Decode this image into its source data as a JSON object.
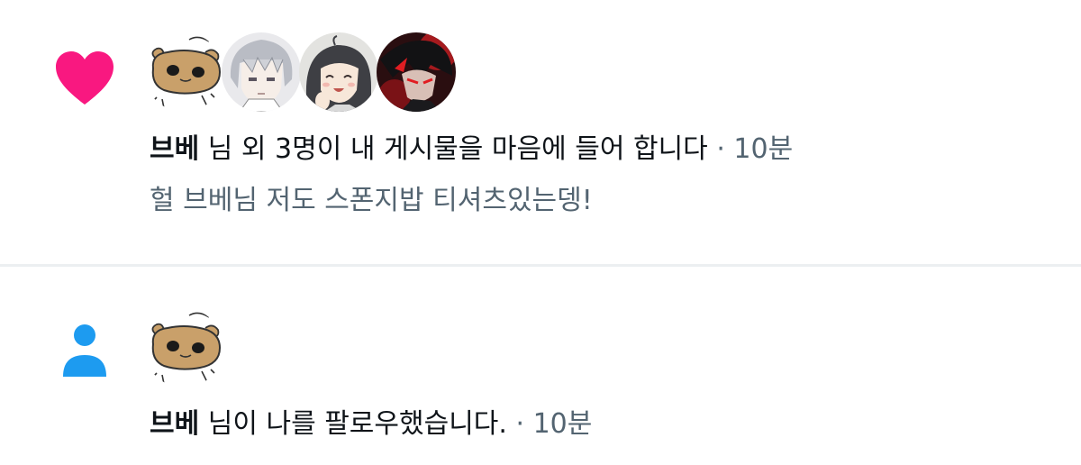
{
  "colors": {
    "heart": "#f91880",
    "person": "#1d9bf0",
    "secondary_text": "#536471",
    "divider": "#eceff1"
  },
  "like_notification": {
    "icon": "heart-icon",
    "avatars": [
      "bear-sketch-avatar",
      "silver-hair-anime-avatar",
      "smiling-girl-anime-avatar",
      "red-dark-anime-avatar"
    ],
    "user_name": "브베",
    "message": " 님 외 3명이 내 게시물을 마음에 들어 합니다",
    "separator": " · ",
    "time": "10분",
    "post_preview": "헐 브베님 저도 스폰지밥 티셔츠있는뎅!"
  },
  "follow_notification": {
    "icon": "person-icon",
    "avatars": [
      "bear-sketch-avatar"
    ],
    "user_name": "브베",
    "message": " 님이 나를 팔로우했습니다.",
    "separator": " · ",
    "time": "10분"
  }
}
